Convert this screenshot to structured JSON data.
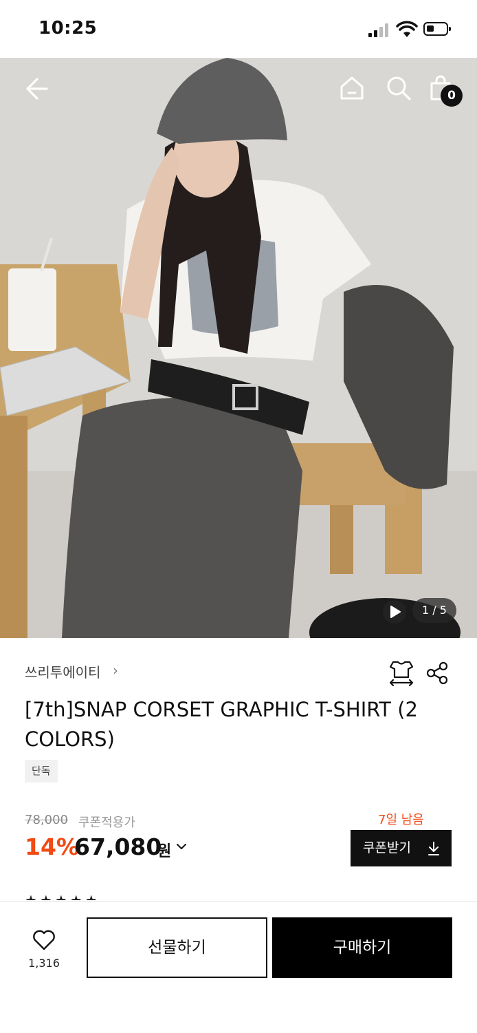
{
  "status_bar": {
    "time": "10:25"
  },
  "hero": {
    "cart_count": "0",
    "pagination": "1 / 5",
    "icons": {
      "back": "back-arrow-icon",
      "home": "home-icon",
      "search": "search-icon",
      "cart": "shopping-bag-icon",
      "video": "play-icon"
    }
  },
  "product": {
    "brand": "쓰리투에이티",
    "brand_chevron": "›",
    "title": "[7th]SNAP CORSET GRAPHIC T-SHIRT (2 COLORS)",
    "badge": "단독",
    "original_price": "78,000",
    "coupon_price_label": "쿠폰적용가",
    "discount": "14%",
    "price": "67,080",
    "currency": "원",
    "days_left": "7일 남음",
    "coupon_button": "쿠폰받기"
  },
  "bottom_bar": {
    "like_count": "1,316",
    "gift_button": "선물하기",
    "buy_button": "구매하기"
  },
  "colors": {
    "accent": "#f24a14",
    "primary": "#111111"
  }
}
